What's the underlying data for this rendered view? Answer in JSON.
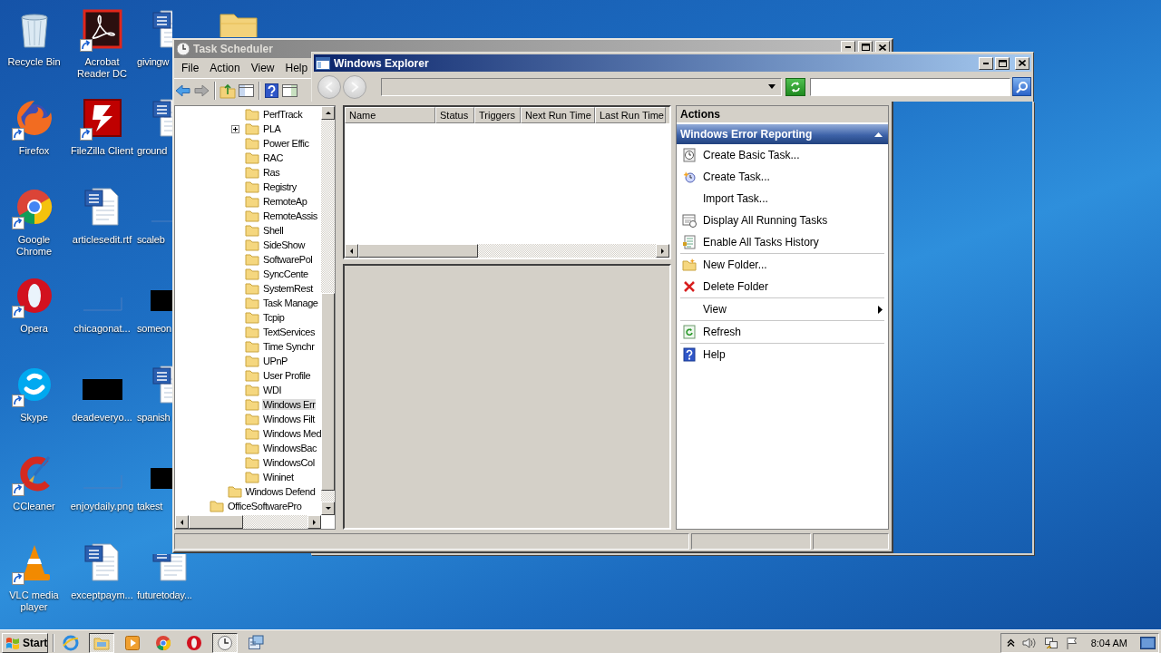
{
  "desktop": {
    "icons": [
      {
        "label": "Recycle Bin",
        "kind": "recycle-bin",
        "shortcut": false
      },
      {
        "label": "Firefox",
        "kind": "firefox",
        "shortcut": true
      },
      {
        "label": "Google Chrome",
        "kind": "chrome",
        "shortcut": true
      },
      {
        "label": "Opera",
        "kind": "opera",
        "shortcut": true
      },
      {
        "label": "Skype",
        "kind": "skype",
        "shortcut": true
      },
      {
        "label": "CCleaner",
        "kind": "ccleaner",
        "shortcut": true
      },
      {
        "label": "VLC media player",
        "kind": "vlc",
        "shortcut": true
      },
      {
        "label": "Acrobat Reader DC",
        "kind": "acrobat",
        "shortcut": true
      },
      {
        "label": "FileZilla Client",
        "kind": "filezilla",
        "shortcut": true
      },
      {
        "label": "articlesedit.rtf",
        "kind": "word",
        "shortcut": false
      },
      {
        "label": "chicagonat...",
        "kind": "thumb-blank",
        "shortcut": false
      },
      {
        "label": "deadeveryo...",
        "kind": "thumb-dark",
        "shortcut": false
      },
      {
        "label": "enjoydaily.png",
        "kind": "thumb-blank",
        "shortcut": false
      },
      {
        "label": "exceptpaym...",
        "kind": "word",
        "shortcut": false
      },
      {
        "label": "givingw",
        "kind": "word",
        "shortcut": false
      },
      {
        "label": "ground",
        "kind": "word",
        "shortcut": false
      },
      {
        "label": "scaleb",
        "kind": "thumb-blank",
        "shortcut": false
      },
      {
        "label": "someon",
        "kind": "thumb-dark",
        "shortcut": false
      },
      {
        "label": "spanish",
        "kind": "word",
        "shortcut": false
      },
      {
        "label": "takest",
        "kind": "thumb-dark",
        "shortcut": false
      },
      {
        "label": "futuretoday...",
        "kind": "word",
        "shortcut": false
      },
      {
        "kind": "folder",
        "shortcut": false
      }
    ]
  },
  "task_scheduler": {
    "title": "Task Scheduler",
    "menu": [
      "File",
      "Action",
      "View",
      "Help"
    ],
    "tree": [
      {
        "children": [
          {
            "children": [
              {
                "label": "PerfTrack",
                "expander": false,
                "selected": false
              },
              {
                "label": "PLA",
                "expander": true,
                "selected": false
              },
              {
                "label": "Power Effic",
                "expander": false,
                "selected": false
              },
              {
                "label": "RAC",
                "expander": false,
                "selected": false
              },
              {
                "label": "Ras",
                "expander": false,
                "selected": false
              },
              {
                "label": "Registry",
                "expander": false,
                "selected": false
              },
              {
                "label": "RemoteAp",
                "expander": false,
                "selected": false
              },
              {
                "label": "RemoteAssis",
                "expander": false,
                "selected": false
              },
              {
                "label": "Shell",
                "expander": false,
                "selected": false
              },
              {
                "label": "SideShow",
                "expander": false,
                "selected": false
              },
              {
                "label": "SoftwarePol",
                "expander": false,
                "selected": false
              },
              {
                "label": "SyncCente",
                "expander": false,
                "selected": false
              },
              {
                "label": "SystemRest",
                "expander": false,
                "selected": false
              },
              {
                "label": "Task Manage",
                "expander": false,
                "selected": false
              },
              {
                "label": "Tcpip",
                "expander": false,
                "selected": false
              },
              {
                "label": "TextServices",
                "expander": false,
                "selected": false
              },
              {
                "label": "Time Synchr",
                "expander": false,
                "selected": false
              },
              {
                "label": "UPnP",
                "expander": false,
                "selected": false
              },
              {
                "label": "User Profile",
                "expander": false,
                "selected": false
              },
              {
                "label": "WDI",
                "expander": false,
                "selected": false
              },
              {
                "label": "Windows Err",
                "expander": false,
                "selected": true
              },
              {
                "label": "Windows Filt",
                "expander": false,
                "selected": false
              },
              {
                "label": "Windows Med",
                "expander": false,
                "selected": false
              },
              {
                "label": "WindowsBac",
                "expander": false,
                "selected": false
              },
              {
                "label": "WindowsCol",
                "expander": false,
                "selected": false
              },
              {
                "label": "Wininet",
                "expander": false,
                "selected": false
              }
            ]
          },
          {
            "label": "Windows Defend",
            "expander": false,
            "selected": false
          }
        ]
      },
      {
        "label": "OfficeSoftwarePro",
        "expander": false,
        "selected": false
      }
    ],
    "list": {
      "columns": [
        "Name",
        "Status",
        "Triggers",
        "Next Run Time",
        "Last Run Time"
      ]
    },
    "actions": {
      "title": "Actions",
      "section": {
        "title": "Windows Error Reporting",
        "expanded": true
      },
      "groups": [
        [
          {
            "label": "Create Basic Task...",
            "kind": "basic-task"
          },
          {
            "label": "Create Task...",
            "kind": "task"
          },
          {
            "label": "Import Task...",
            "kind": "plain"
          },
          {
            "label": "Display All Running Tasks",
            "kind": "running"
          },
          {
            "label": "Enable All Tasks History",
            "kind": "history"
          }
        ],
        [
          {
            "label": "New Folder...",
            "kind": "new-folder"
          },
          {
            "label": "Delete Folder",
            "kind": "delete"
          }
        ],
        [
          {
            "label": "View",
            "kind": "submenu"
          }
        ],
        [
          {
            "label": "Refresh",
            "kind": "refresh"
          }
        ],
        [
          {
            "label": "Help",
            "kind": "help"
          }
        ]
      ]
    }
  },
  "explorer": {
    "title": "Windows Explorer",
    "back": {
      "disabled": true
    },
    "forward": {
      "disabled": true
    }
  },
  "taskbar": {
    "start": "Start",
    "buttons": [
      {
        "kind": "ie",
        "active": false
      },
      {
        "kind": "explorer",
        "active": true
      },
      {
        "kind": "media",
        "active": false
      },
      {
        "kind": "chrome",
        "active": false
      },
      {
        "kind": "opera",
        "active": false
      },
      {
        "kind": "clock",
        "active": true
      },
      {
        "kind": "app",
        "active": false
      }
    ],
    "clock": "8:04 AM"
  }
}
